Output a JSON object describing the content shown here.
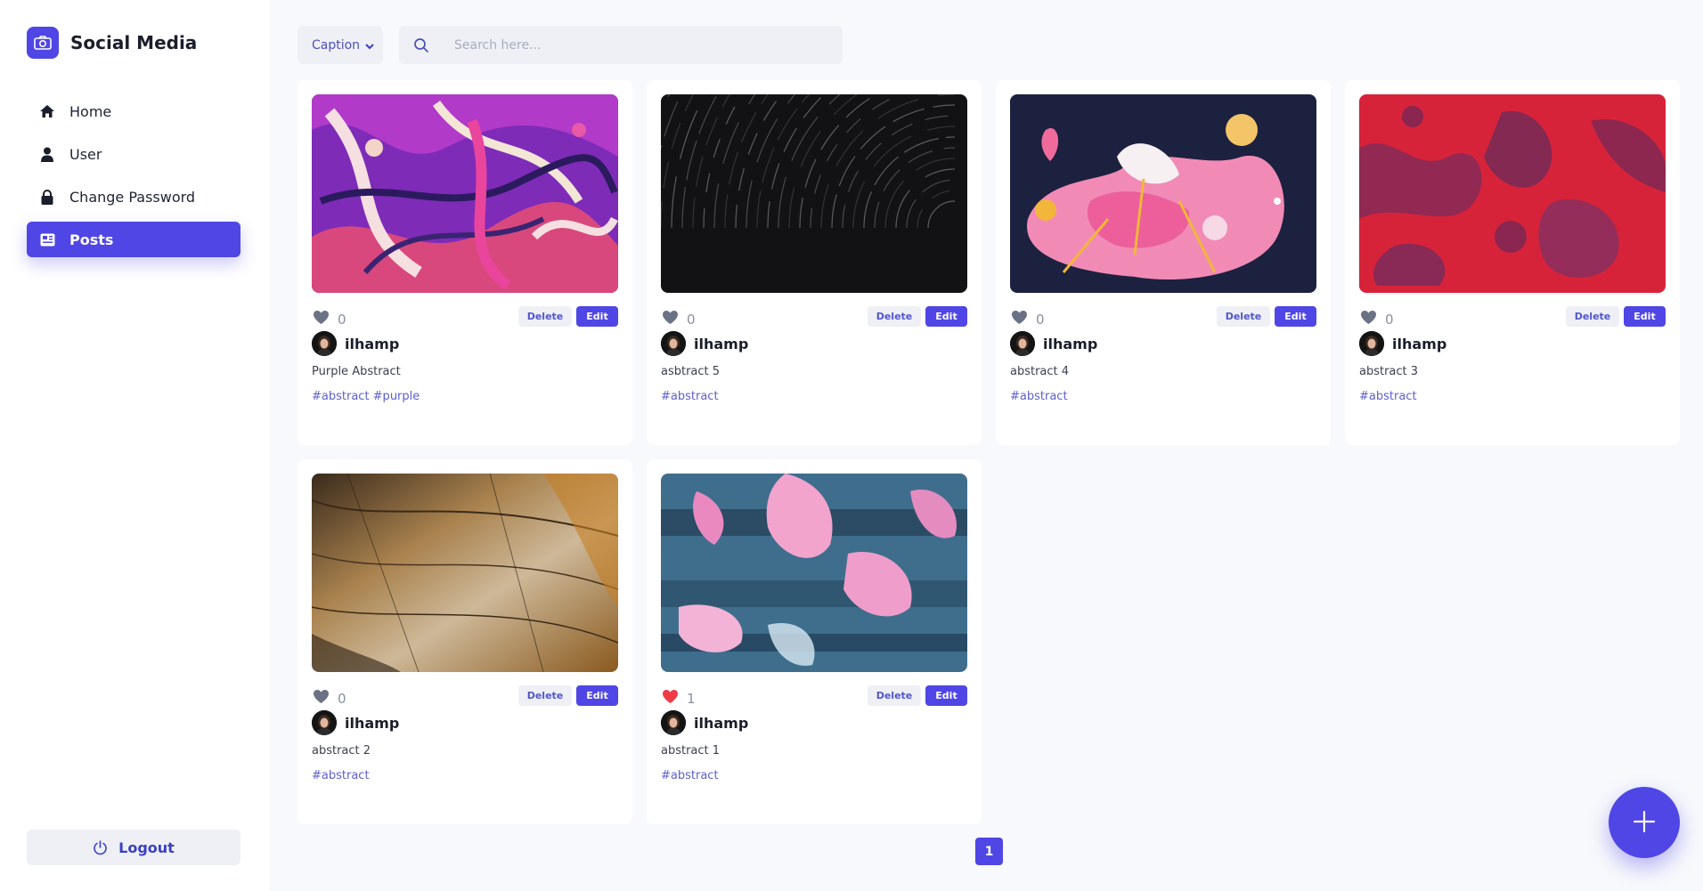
{
  "app": {
    "title": "Social Media"
  },
  "sidebar": {
    "items": [
      {
        "label": "Home",
        "icon": "home-icon",
        "active": false
      },
      {
        "label": "User",
        "icon": "user-icon",
        "active": false
      },
      {
        "label": "Change Password",
        "icon": "lock-icon",
        "active": false
      },
      {
        "label": "Posts",
        "icon": "posts-icon",
        "active": true
      }
    ],
    "logout_label": "Logout"
  },
  "toolbar": {
    "filter_value": "Caption",
    "search_placeholder": "Search here..."
  },
  "colors": {
    "accent": "#4f46e5",
    "like_active": "#ef3b47",
    "like_inactive": "#6b7285"
  },
  "posts": [
    {
      "author": "ilhamp",
      "caption": "Purple Abstract",
      "tags": "#abstract #purple",
      "likes": "0",
      "liked": false,
      "image": "purple-abstract-image",
      "delete_label": "Delete",
      "edit_label": "Edit"
    },
    {
      "author": "ilhamp",
      "caption": "asbtract 5",
      "tags": "#abstract",
      "likes": "0",
      "liked": false,
      "image": "star-trails-image",
      "delete_label": "Delete",
      "edit_label": "Edit"
    },
    {
      "author": "ilhamp",
      "caption": "abstract 4",
      "tags": "#abstract",
      "likes": "0",
      "liked": false,
      "image": "pink-splash-image",
      "delete_label": "Delete",
      "edit_label": "Edit"
    },
    {
      "author": "ilhamp",
      "caption": "abstract 3",
      "tags": "#abstract",
      "likes": "0",
      "liked": false,
      "image": "red-texture-image",
      "delete_label": "Delete",
      "edit_label": "Edit"
    },
    {
      "author": "ilhamp",
      "caption": "abstract 2",
      "tags": "#abstract",
      "likes": "0",
      "liked": false,
      "image": "wood-texture-image",
      "delete_label": "Delete",
      "edit_label": "Edit"
    },
    {
      "author": "ilhamp",
      "caption": "abstract 1",
      "tags": "#abstract",
      "likes": "1",
      "liked": true,
      "image": "blue-pink-paint-image",
      "delete_label": "Delete",
      "edit_label": "Edit"
    }
  ],
  "pagination": {
    "current_page": "1"
  },
  "fab": {
    "icon": "plus-icon"
  }
}
